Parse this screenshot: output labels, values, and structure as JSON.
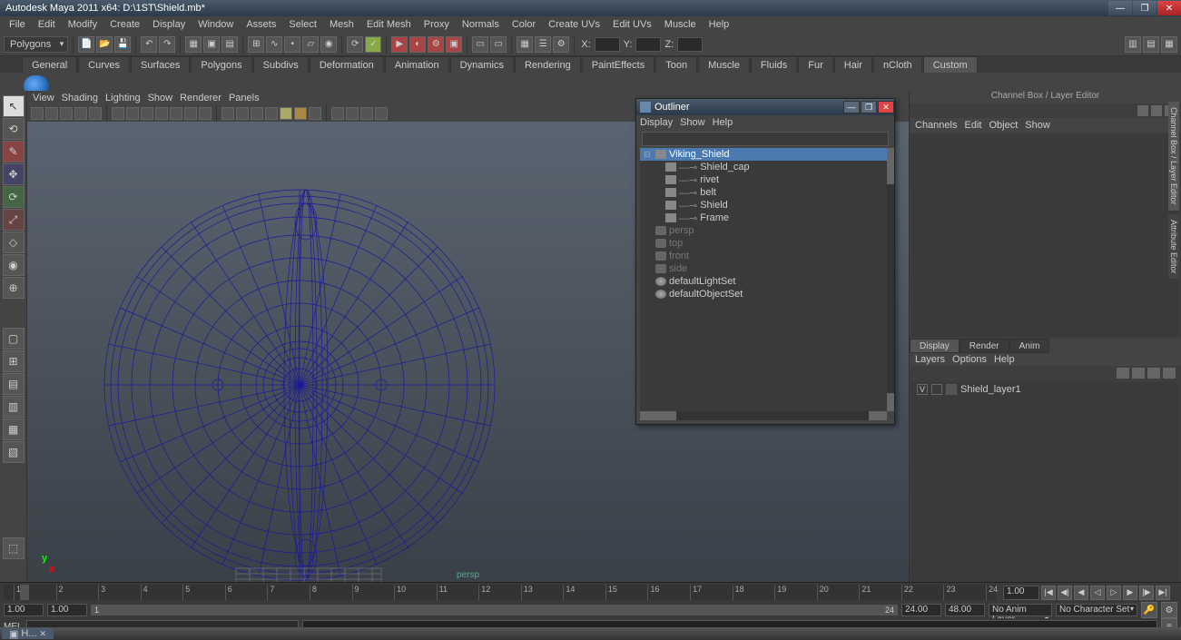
{
  "window": {
    "title": "Autodesk Maya 2011 x64: D:\\1ST\\Shield.mb*"
  },
  "menubar": [
    "File",
    "Edit",
    "Modify",
    "Create",
    "Display",
    "Window",
    "Assets",
    "Select",
    "Mesh",
    "Edit Mesh",
    "Proxy",
    "Normals",
    "Color",
    "Create UVs",
    "Edit UVs",
    "Muscle",
    "Help"
  ],
  "toolbar": {
    "mode": "Polygons",
    "x_label": "X:",
    "y_label": "Y:",
    "z_label": "Z:"
  },
  "shelf_tabs": [
    "General",
    "Curves",
    "Surfaces",
    "Polygons",
    "Subdivs",
    "Deformation",
    "Animation",
    "Dynamics",
    "Rendering",
    "PaintEffects",
    "Toon",
    "Muscle",
    "Fluids",
    "Fur",
    "Hair",
    "nCloth",
    "Custom"
  ],
  "viewport": {
    "menu": [
      "View",
      "Shading",
      "Lighting",
      "Show",
      "Renderer",
      "Panels"
    ],
    "label": "persp",
    "axis_y": "y",
    "axis_x": "x"
  },
  "outliner": {
    "title": "Outliner",
    "menu": [
      "Display",
      "Show",
      "Help"
    ],
    "items": [
      {
        "name": "Viking_Shield",
        "selected": true,
        "expand": true,
        "icon": "mesh"
      },
      {
        "name": "Shield_cap",
        "indent": 1,
        "icon": "mesh"
      },
      {
        "name": "rivet",
        "indent": 1,
        "icon": "mesh"
      },
      {
        "name": "belt",
        "indent": 1,
        "icon": "mesh"
      },
      {
        "name": "Shield",
        "indent": 1,
        "icon": "mesh"
      },
      {
        "name": "Frame",
        "indent": 1,
        "icon": "mesh"
      },
      {
        "name": "persp",
        "dim": true,
        "icon": "cam"
      },
      {
        "name": "top",
        "dim": true,
        "icon": "cam"
      },
      {
        "name": "front",
        "dim": true,
        "icon": "cam"
      },
      {
        "name": "side",
        "dim": true,
        "icon": "cam"
      },
      {
        "name": "defaultLightSet",
        "icon": "set"
      },
      {
        "name": "defaultObjectSet",
        "icon": "set"
      }
    ]
  },
  "channel_box": {
    "title": "Channel Box / Layer Editor",
    "menu": [
      "Channels",
      "Edit",
      "Object",
      "Show"
    ],
    "layer_tabs": [
      "Display",
      "Render",
      "Anim"
    ],
    "layer_menu": [
      "Layers",
      "Options",
      "Help"
    ],
    "layers": [
      {
        "vis": "V",
        "name": "Shield_layer1"
      }
    ]
  },
  "vert_tabs": [
    "Channel Box / Layer Editor",
    "Attribute Editor"
  ],
  "timeline": {
    "current_frame": "1.00",
    "ticks": [
      "1",
      "2",
      "3",
      "4",
      "5",
      "6",
      "7",
      "8",
      "9",
      "10",
      "11",
      "12",
      "13",
      "14",
      "15",
      "16",
      "17",
      "18",
      "19",
      "20",
      "21",
      "22",
      "23",
      "24"
    ]
  },
  "range": {
    "start_out": "1.00",
    "start_in": "1.00",
    "thumb_left": "1",
    "thumb_right": "24",
    "end_in": "24.00",
    "end_out": "48.00",
    "anim_layer": "No Anim Layer",
    "char_set": "No Character Set"
  },
  "cmd": {
    "mode": "MEL"
  },
  "taskbar": {
    "item": "H..."
  }
}
